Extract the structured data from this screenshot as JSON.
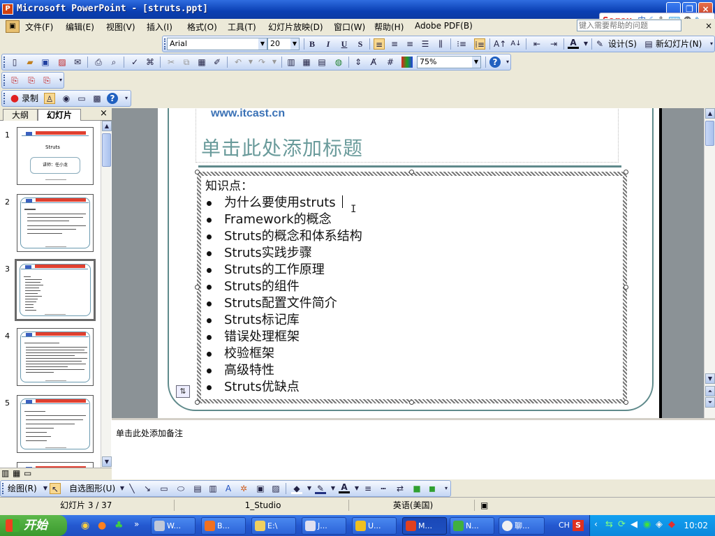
{
  "window": {
    "title": "Microsoft PowerPoint - [struts.ppt]",
    "app_icon": "P"
  },
  "window_buttons": {
    "minimize": "_",
    "restore": "❐",
    "close": "×"
  },
  "sogou": {
    "logo": "Sogou",
    "mode": "中"
  },
  "menu": [
    "文件(F)",
    "编辑(E)",
    "视图(V)",
    "插入(I)",
    "格式(O)",
    "工具(T)",
    "幻灯片放映(D)",
    "窗口(W)",
    "帮助(H)",
    "Adobe PDF(B)"
  ],
  "help_search": {
    "placeholder": "键入需要帮助的问题"
  },
  "format_toolbar": {
    "font_name": "Arial",
    "font_size": "20",
    "bold": "B",
    "italic": "I",
    "underline": "U",
    "shadow": "S",
    "design_label": "设计(S)",
    "new_slide_label": "新幻灯片(N)"
  },
  "standard_toolbar": {
    "zoom": "75%"
  },
  "record_toolbar": {
    "record_label": "录制"
  },
  "left_pane": {
    "tab_outline": "大纲",
    "tab_slides": "幻灯片",
    "close": "×",
    "slide_numbers": [
      "1",
      "2",
      "3",
      "4",
      "5"
    ],
    "selected_slide": "3",
    "thumb1_title": "Struts",
    "thumb1_sub": "讲师：任小龙"
  },
  "slide": {
    "url": "www.itcast.cn",
    "title_placeholder": "单击此处添加标题",
    "lead": "知识点：",
    "bullets": [
      "为什么要使用struts",
      "Framework的概念",
      "Struts的概念和体系结构",
      "Struts实践步骤",
      "Struts的工作原理",
      "Struts的组件",
      "Struts配置文件简介",
      "Struts标记库",
      "错误处理框架",
      "校验框架",
      "高级特性",
      "Struts优缺点"
    ]
  },
  "notes": {
    "placeholder": "单击此处添加备注"
  },
  "draw_toolbar": {
    "draw_label": "绘图(R)",
    "autoshapes_label": "自选图形(U)"
  },
  "status": {
    "slide_pos": "幻灯片 3 / 37",
    "design": "1_Studio",
    "language": "英语(美国)"
  },
  "taskbar": {
    "start": "开始",
    "tasks": [
      "W...",
      "B...",
      "E:\\",
      "J...",
      "U...",
      "M...",
      "N...",
      "聊..."
    ],
    "tray_lang": "CH",
    "clock": "10:02"
  }
}
